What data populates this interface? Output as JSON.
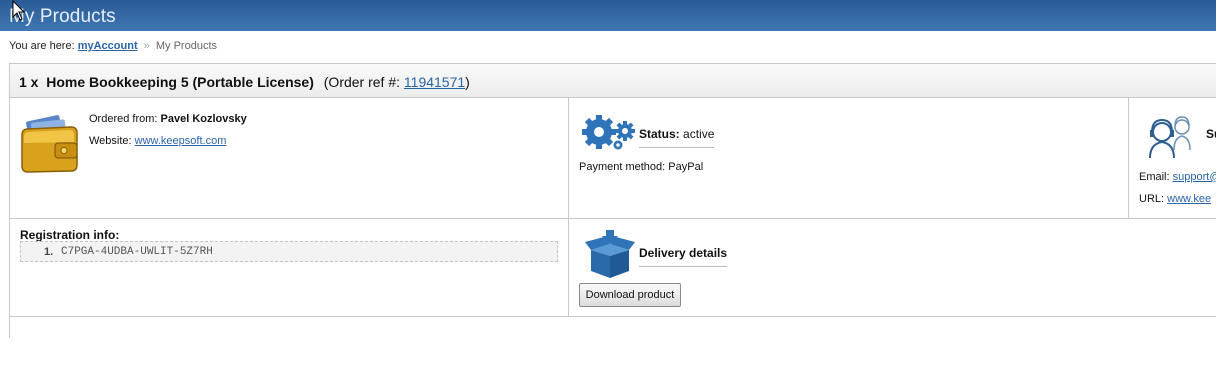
{
  "header": {
    "title": "My Products"
  },
  "breadcrumb": {
    "prefix": "You are here:",
    "link": "myAccount",
    "separator": "»",
    "current": "My Products"
  },
  "order": {
    "quantity": "1 x",
    "product": "Home Bookkeeping 5 (Portable License)",
    "ref_label": "(Order ref #:",
    "ref_number": "11941571",
    "ref_close": ")"
  },
  "vendor": {
    "ordered_from_label": "Ordered from:",
    "ordered_from_name": "Pavel Kozlovsky",
    "website_label": "Website:",
    "website_url": "www.keepsoft.com"
  },
  "status": {
    "label": "Status:",
    "value": "active",
    "payment_label": "Payment method:",
    "payment_value": "PayPal"
  },
  "support": {
    "title": "Su",
    "email_label": "Email:",
    "email_value": "support@",
    "url_label": "URL:",
    "url_value": "www.kee"
  },
  "registration": {
    "label": "Registration info:",
    "items": [
      {
        "number": "1.",
        "key": "C7PGA-4UDBA-UWLIT-5Z7RH"
      }
    ]
  },
  "delivery": {
    "title": "Delivery details",
    "button_label": "Download product"
  },
  "icons": {
    "wallet": "wallet-icon",
    "gears": "gears-icon",
    "support": "support-headset-icon",
    "box": "package-box-icon",
    "cursor": "mouse-cursor-icon"
  },
  "colors": {
    "header_bg": "#3a6fa8",
    "link": "#2a64a8",
    "gear_blue": "#2f73b8",
    "wallet_gold": "#d8a21c"
  }
}
